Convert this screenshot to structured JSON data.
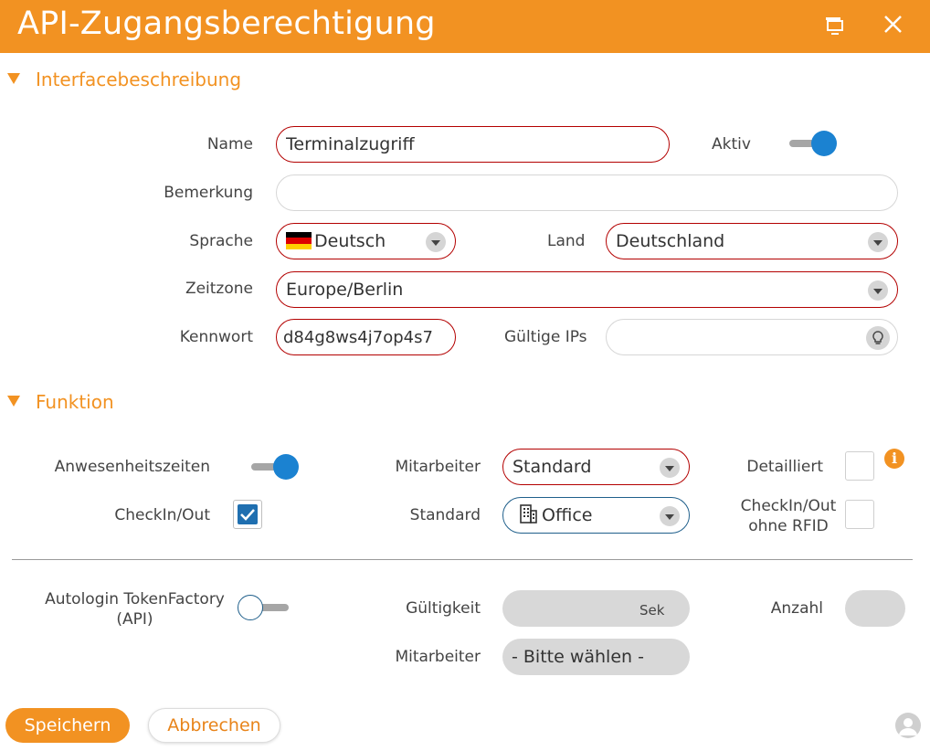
{
  "window": {
    "title": "API-Zugangsberechtigung",
    "accent_color": "#f29222",
    "restore_icon": "restore-window-icon",
    "close_icon": "close-icon"
  },
  "section_interface": {
    "title": "Interfacebeschreibung"
  },
  "section_function": {
    "title": "Funktion"
  },
  "fields": {
    "name": {
      "label": "Name",
      "value": "Terminalzugriff"
    },
    "aktiv": {
      "label": "Aktiv",
      "state": "on"
    },
    "bemerkung": {
      "label": "Bemerkung",
      "value": ""
    },
    "sprache": {
      "label": "Sprache",
      "value": "Deutsch",
      "flag_icon": "germany-flag-icon"
    },
    "land": {
      "label": "Land",
      "value": "Deutschland"
    },
    "zeitzone": {
      "label": "Zeitzone",
      "value": "Europe/Berlin"
    },
    "kennwort": {
      "label": "Kennwort",
      "value": "d84g8ws4j7op4s7"
    },
    "gueltige_ips": {
      "label": "Gültige IPs",
      "value": "",
      "icon": "lightbulb-icon"
    }
  },
  "funktion": {
    "anwesenheitszeiten": {
      "label": "Anwesenheitszeiten",
      "state": "on"
    },
    "mitarbeiter": {
      "label": "Mitarbeiter",
      "value": "Standard"
    },
    "detailliert": {
      "label": "Detailliert",
      "checked": false,
      "info_icon": "info-icon",
      "info_text": "i"
    },
    "checkin_out": {
      "label": "CheckIn/Out",
      "checked": true
    },
    "standard": {
      "label": "Standard",
      "value": "Office",
      "icon": "building-icon"
    },
    "checkin_out_ohne_rfid": {
      "label_line1": "CheckIn/Out",
      "label_line2": "ohne RFID",
      "checked": false
    }
  },
  "autologin": {
    "label_line1": "Autologin TokenFactory",
    "label_line2": "(API)",
    "state": "off",
    "gueltigkeit": {
      "label": "Gültigkeit",
      "unit": "Sek"
    },
    "anzahl": {
      "label": "Anzahl"
    },
    "mitarbeiter": {
      "label": "Mitarbeiter",
      "value": "- Bitte wählen -"
    }
  },
  "footer": {
    "save_label": "Speichern",
    "cancel_label": "Abbrechen",
    "avatar_icon": "user-avatar-icon"
  }
}
